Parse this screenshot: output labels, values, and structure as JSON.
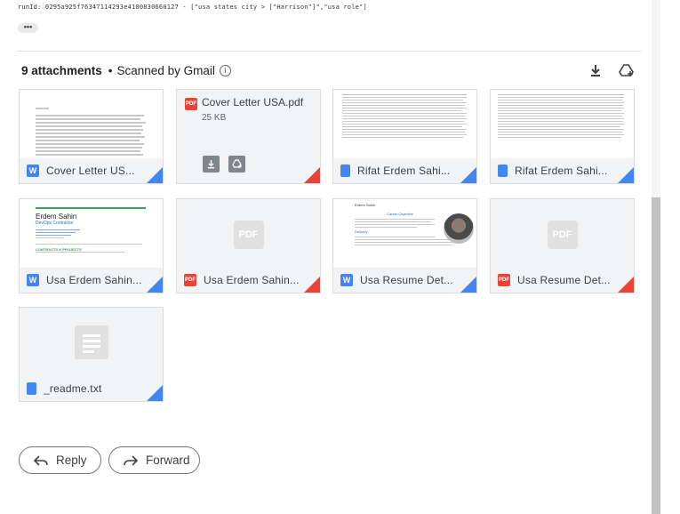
{
  "message": {
    "meta_line": "runId: 0295a925f76347114293e4100830660127 - [\"usa states city > [\"Harrison\"]\",\"usa role\"]",
    "more_label": "•••"
  },
  "attachments": {
    "count_label": "9 attachments",
    "scan_label": "Scanned by Gmail",
    "items": [
      {
        "name": "Cover Letter US...",
        "type": "word"
      },
      {
        "name": "Cover Letter USA.pdf",
        "type": "pdf",
        "size": "25 KB"
      },
      {
        "name": "Rifat Erdem Sahi...",
        "type": "doc"
      },
      {
        "name": "Rifat Erdem Sahi...",
        "type": "sheet"
      },
      {
        "name": "Usa Erdem Sahin...",
        "type": "word"
      },
      {
        "name": "Usa Erdem Sahin...",
        "type": "pdf"
      },
      {
        "name": "Usa Resume Det...",
        "type": "word"
      },
      {
        "name": "Usa Resume Det...",
        "type": "pdf"
      },
      {
        "name": "_readme.txt",
        "type": "doc"
      }
    ],
    "preview_text": {
      "resume_name": "Erdem Sahin",
      "resume_role": "DevOps Contractor",
      "resume_section": "CONTRACTS & PROJECTS",
      "resume2_name": "Erdem Sahin",
      "resume2_section": "Career Objective",
      "resume2_sub": "Delivery"
    },
    "pdf_placeholder": "PDF"
  },
  "actions": {
    "reply": "Reply",
    "forward": "Forward"
  },
  "colors": {
    "word_blue": "#4285f4",
    "pdf_red": "#ea4335"
  }
}
